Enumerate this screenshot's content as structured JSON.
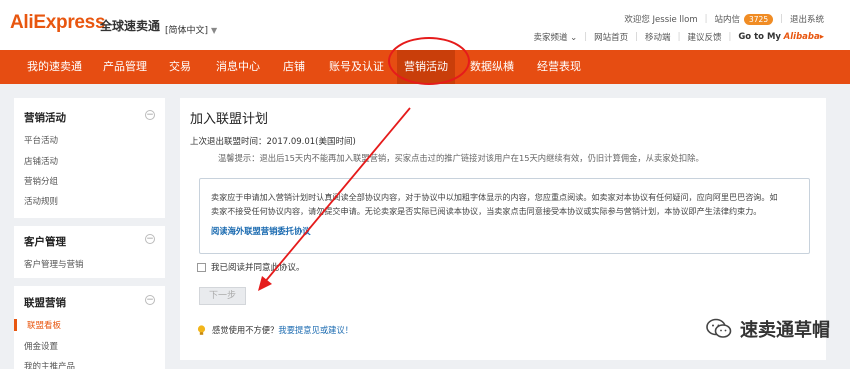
{
  "header": {
    "logo_text": "AliExpress",
    "logo_cn": "全球速卖通",
    "language": "[简体中文]",
    "welcome": "欢迎您 Jessie llom",
    "inbox_label": "站内信",
    "inbox_count": "3725",
    "logout": "退出系统",
    "seller_channel": "卖家频道",
    "site_home": "网站首页",
    "mobile": "移动端",
    "suggest": "建议反馈",
    "goto_prefix": "Go to My",
    "goto_brand": "Alibaba",
    "goto_suffix": "▸"
  },
  "nav": {
    "items": [
      {
        "label": "我的速卖通"
      },
      {
        "label": "产品管理"
      },
      {
        "label": "交易"
      },
      {
        "label": "消息中心"
      },
      {
        "label": "店铺"
      },
      {
        "label": "账号及认证"
      },
      {
        "label": "营销活动"
      },
      {
        "label": "数据纵横"
      },
      {
        "label": "经营表现"
      }
    ],
    "active_index": 6
  },
  "sidebar": {
    "groups": [
      {
        "title": "营销活动",
        "toggle": "−",
        "links": [
          "平台活动",
          "店铺活动",
          "营销分组",
          "活动规则"
        ]
      },
      {
        "title": "客户管理",
        "toggle": "−",
        "links": [
          "客户管理与营销"
        ]
      },
      {
        "title": "联盟营销",
        "toggle": "−",
        "links": [
          "联盟看板",
          "佣金设置",
          "我的主推产品"
        ]
      }
    ]
  },
  "main": {
    "title": "加入联盟计划",
    "last_exit": "上次退出联盟时间：2017.09.01(美国时间)",
    "tip": "温馨提示：退出后15天内不能再加入联盟营销，买家点击过的推广链接对该用户在15天内继续有效，仍旧计算佣金，从卖家处扣除。",
    "agreement_line1": "卖家应于申请加入营销计划时认真阅读全部协议内容，对于协议中以加粗字体显示的内容，您应重点阅读。如卖家对本协议有任何疑问，应向阿里巴巴咨询。如",
    "agreement_line2": "卖家不接受任何协议内容，请勿提交申请。无论卖家是否实际已阅读本协议，当卖家点击同意接受本协议或实际参与营销计划，本协议即产生法律约束力。",
    "agreement_link": "阅读海外联盟营销委托协议",
    "checkbox_label": "我已阅读并同意此协议。",
    "next_button": "下一步",
    "feedback_text": "感觉使用不方便？",
    "feedback_link": "我要提意见或建议！"
  },
  "watermark": {
    "text": "速卖通草帽"
  },
  "colors": {
    "brand_orange": "#e64d12",
    "annotation_red": "#e51b1b",
    "link_blue": "#1a6ab0"
  }
}
